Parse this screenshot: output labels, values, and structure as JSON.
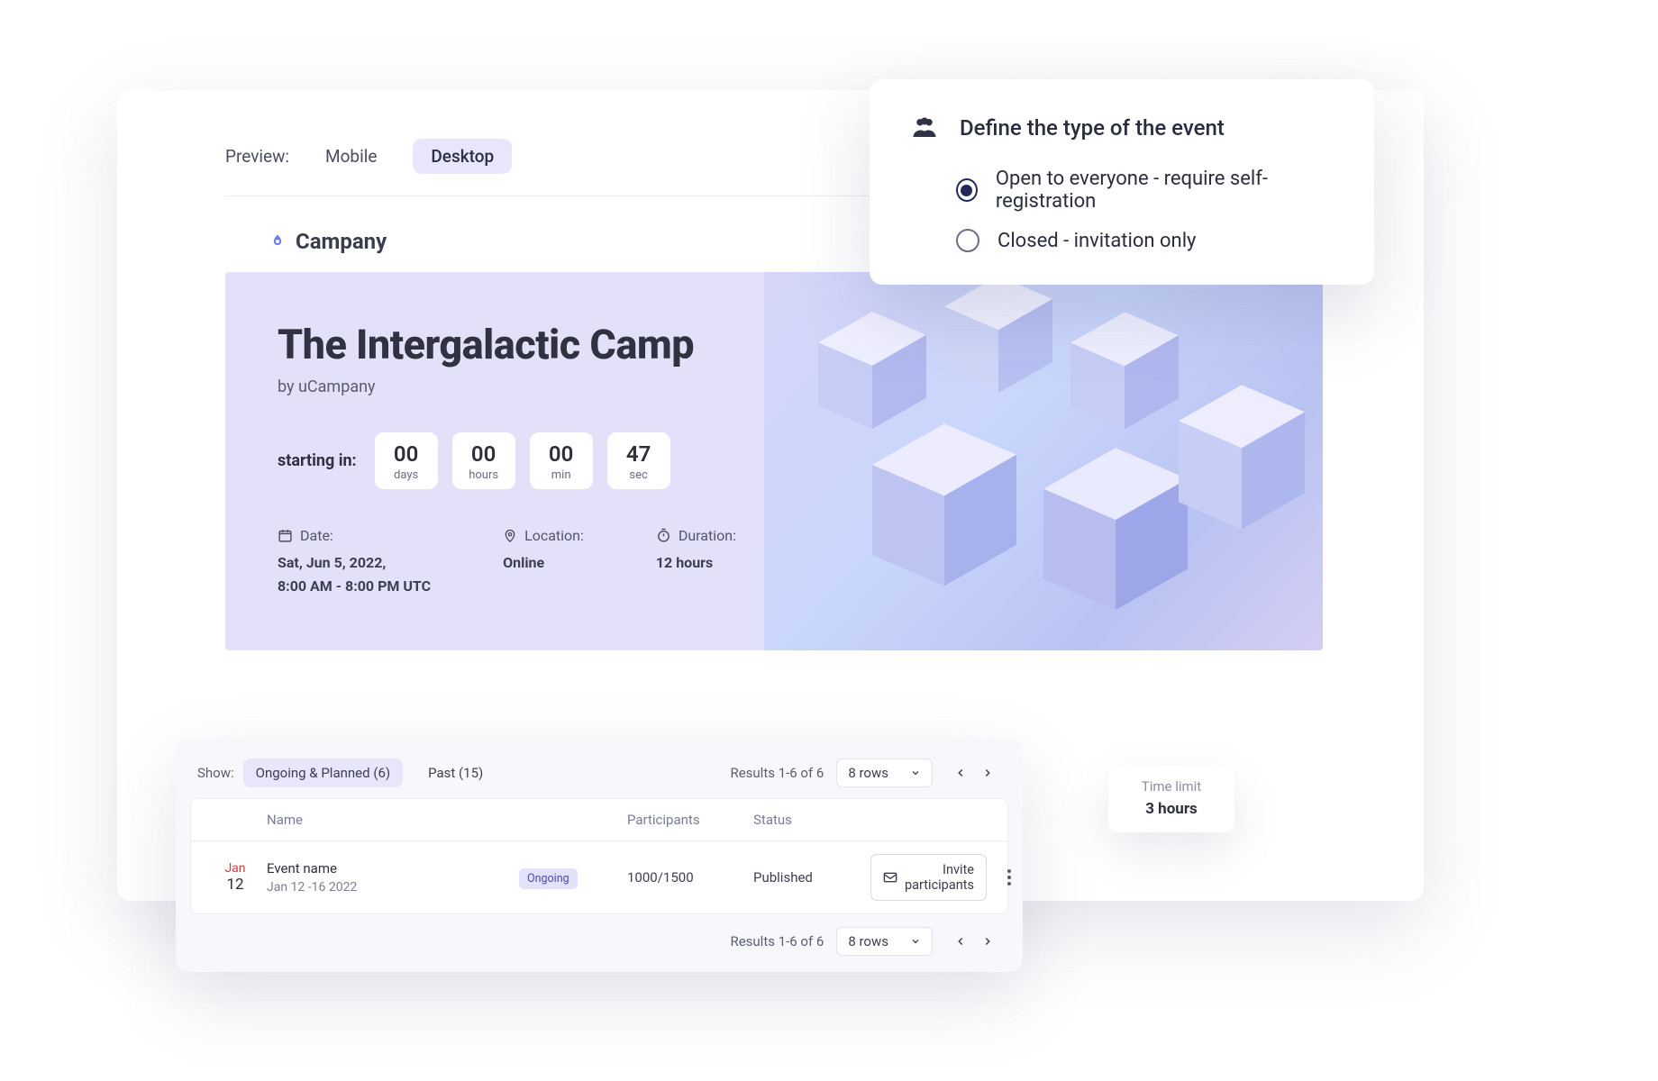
{
  "preview": {
    "label": "Preview:",
    "tabs": {
      "mobile": "Mobile",
      "desktop": "Desktop"
    },
    "active": "desktop"
  },
  "brand": {
    "name": "Campany"
  },
  "hero": {
    "title": "The Intergalactic Camp",
    "subtitle": "by uCampany",
    "starting_label": "starting in:",
    "countdown": {
      "days": {
        "value": "00",
        "unit": "days"
      },
      "hours": {
        "value": "00",
        "unit": "hours"
      },
      "min": {
        "value": "00",
        "unit": "min"
      },
      "sec": {
        "value": "47",
        "unit": "sec"
      }
    },
    "meta": {
      "date": {
        "label": "Date:",
        "line1": "Sat, Jun 5, 2022,",
        "line2": "8:00 AM - 8:00 PM UTC"
      },
      "location": {
        "label": "Location:",
        "value": "Online"
      },
      "duration": {
        "label": "Duration:",
        "value": "12 hours"
      }
    }
  },
  "type_card": {
    "title": "Define the type of the event",
    "options": {
      "open": "Open to everyone - require self-registration",
      "closed": "Closed - invitation only"
    },
    "selected": "open"
  },
  "timelimit": {
    "label": "Time limit",
    "value": "3 hours"
  },
  "table": {
    "show_label": "Show:",
    "filters": {
      "ongoing": "Ongoing & Planned (6)",
      "past": "Past (15)"
    },
    "results_text": "Results 1-6 of 6",
    "rows_select": "8 rows",
    "columns": {
      "name": "Name",
      "participants": "Participants",
      "status": "Status"
    },
    "row": {
      "month": "Jan",
      "day": "12",
      "event_name": "Event name",
      "date_range": "Jan 12 -16 2022",
      "badge": "Ongoing",
      "participants": "1000/1500",
      "status": "Published",
      "invite_label": "Invite participants"
    }
  }
}
